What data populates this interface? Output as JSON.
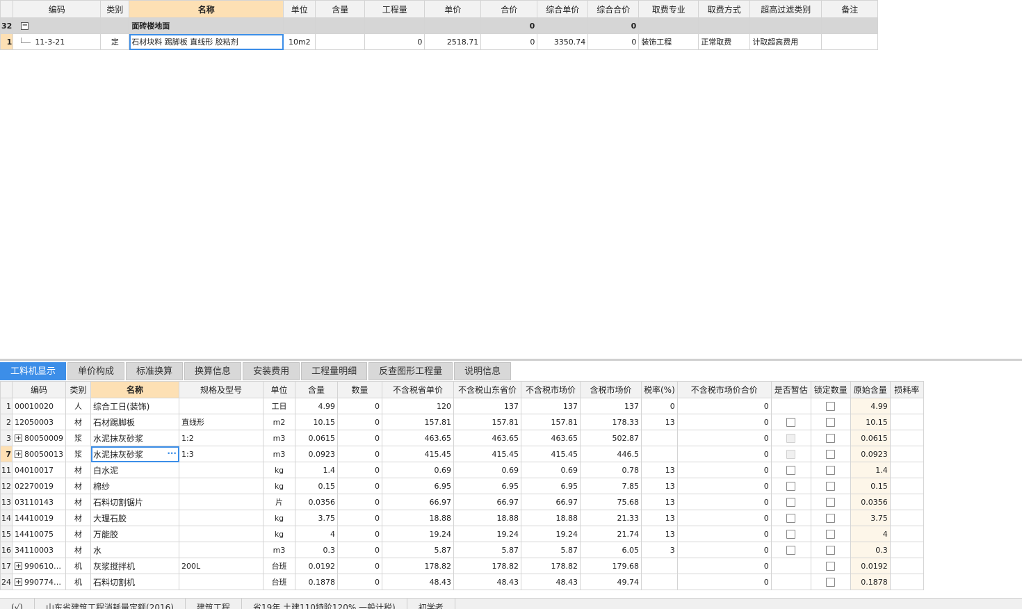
{
  "top_table": {
    "headers": [
      "编码",
      "类别",
      "名称",
      "单位",
      "含量",
      "工程量",
      "单价",
      "合价",
      "综合单价",
      "综合合价",
      "取费专业",
      "取费方式",
      "超高过滤类别",
      "备注"
    ],
    "group_row": {
      "row_num": "32",
      "collapse_glyph": "−",
      "name": "面砖楼地面",
      "price_sum": "0",
      "comp_sum": "0"
    },
    "item_row": {
      "row_num": "1",
      "code": "11-3-21",
      "type": "定",
      "name": "石材块料 踢脚板 直线形 胶粘剂",
      "unit": "10m2",
      "content": "",
      "qty": "0",
      "price": "2518.71",
      "total": "0",
      "comp_price": "3350.74",
      "comp_total": "0",
      "fee_major": "装饰工程",
      "fee_method": "正常取费",
      "filter": "计取超高费用",
      "note": ""
    }
  },
  "tabs": [
    "工料机显示",
    "单价构成",
    "标准换算",
    "换算信息",
    "安装费用",
    "工程量明细",
    "反查图形工程量",
    "说明信息"
  ],
  "bottom_table": {
    "headers": [
      "编码",
      "类别",
      "名称",
      "规格及型号",
      "单位",
      "含量",
      "数量",
      "不含税省单价",
      "不含税山东省价",
      "不含税市场价",
      "含税市场价",
      "税率(%)",
      "不含税市场价合价",
      "是否暂估",
      "锁定数量",
      "原始含量",
      "损耗率"
    ],
    "rows": [
      {
        "n": "1",
        "exp": false,
        "code": "00010020",
        "type": "人",
        "name": "综合工日(装饰)",
        "spec": "",
        "unit": "工日",
        "content": "4.99",
        "qty": "0",
        "p1": "120",
        "p2": "137",
        "p3": "137",
        "p4": "137",
        "tax": "0",
        "sum": "0",
        "est": "none",
        "orig": "4.99",
        "loss": ""
      },
      {
        "n": "2",
        "exp": false,
        "code": "12050003",
        "type": "材",
        "name": "石材踢脚板",
        "spec": "直线形",
        "unit": "m2",
        "content": "10.15",
        "qty": "0",
        "p1": "157.81",
        "p2": "157.81",
        "p3": "157.81",
        "p4": "178.33",
        "tax": "13",
        "sum": "0",
        "est": "box",
        "orig": "10.15",
        "loss": ""
      },
      {
        "n": "3",
        "exp": true,
        "code": "80050009",
        "type": "浆",
        "name": "水泥抹灰砂浆",
        "spec": "1:2",
        "unit": "m3",
        "content": "0.0615",
        "qty": "0",
        "p1": "463.65",
        "p2": "463.65",
        "p3": "463.65",
        "p4": "502.87",
        "tax": "",
        "sum": "0",
        "est": "dis",
        "orig": "0.0615",
        "loss": ""
      },
      {
        "n": "7",
        "exp": true,
        "code": "80050013",
        "type": "浆",
        "name": "水泥抹灰砂浆",
        "spec": "1:3",
        "unit": "m3",
        "content": "0.0923",
        "qty": "0",
        "p1": "415.45",
        "p2": "415.45",
        "p3": "415.45",
        "p4": "446.5",
        "tax": "",
        "sum": "0",
        "est": "dis",
        "orig": "0.0923",
        "loss": ""
      },
      {
        "n": "11",
        "exp": false,
        "code": "04010017",
        "type": "材",
        "name": "白水泥",
        "spec": "",
        "unit": "kg",
        "content": "1.4",
        "qty": "0",
        "p1": "0.69",
        "p2": "0.69",
        "p3": "0.69",
        "p4": "0.78",
        "tax": "13",
        "sum": "0",
        "est": "box",
        "orig": "1.4",
        "loss": ""
      },
      {
        "n": "12",
        "exp": false,
        "code": "02270019",
        "type": "材",
        "name": "棉纱",
        "spec": "",
        "unit": "kg",
        "content": "0.15",
        "qty": "0",
        "p1": "6.95",
        "p2": "6.95",
        "p3": "6.95",
        "p4": "7.85",
        "tax": "13",
        "sum": "0",
        "est": "box",
        "orig": "0.15",
        "loss": ""
      },
      {
        "n": "13",
        "exp": false,
        "code": "03110143",
        "type": "材",
        "name": "石料切割锯片",
        "spec": "",
        "unit": "片",
        "content": "0.0356",
        "qty": "0",
        "p1": "66.97",
        "p2": "66.97",
        "p3": "66.97",
        "p4": "75.68",
        "tax": "13",
        "sum": "0",
        "est": "box",
        "orig": "0.0356",
        "loss": ""
      },
      {
        "n": "14",
        "exp": false,
        "code": "14410019",
        "type": "材",
        "name": "大理石胶",
        "spec": "",
        "unit": "kg",
        "content": "3.75",
        "qty": "0",
        "p1": "18.88",
        "p2": "18.88",
        "p3": "18.88",
        "p4": "21.33",
        "tax": "13",
        "sum": "0",
        "est": "box",
        "orig": "3.75",
        "loss": ""
      },
      {
        "n": "15",
        "exp": false,
        "code": "14410075",
        "type": "材",
        "name": "万能胶",
        "spec": "",
        "unit": "kg",
        "content": "4",
        "qty": "0",
        "p1": "19.24",
        "p2": "19.24",
        "p3": "19.24",
        "p4": "21.74",
        "tax": "13",
        "sum": "0",
        "est": "box",
        "orig": "4",
        "loss": ""
      },
      {
        "n": "16",
        "exp": false,
        "code": "34110003",
        "type": "材",
        "name": "水",
        "spec": "",
        "unit": "m3",
        "content": "0.3",
        "qty": "0",
        "p1": "5.87",
        "p2": "5.87",
        "p3": "5.87",
        "p4": "6.05",
        "tax": "3",
        "sum": "0",
        "est": "box",
        "orig": "0.3",
        "loss": ""
      },
      {
        "n": "17",
        "exp": true,
        "code": "990610…",
        "type": "机",
        "name": "灰浆搅拌机",
        "spec": "200L",
        "unit": "台班",
        "content": "0.0192",
        "qty": "0",
        "p1": "178.82",
        "p2": "178.82",
        "p3": "178.82",
        "p4": "179.68",
        "tax": "",
        "sum": "0",
        "est": "none",
        "orig": "0.0192",
        "loss": ""
      },
      {
        "n": "24",
        "exp": true,
        "code": "990774…",
        "type": "机",
        "name": "石料切割机",
        "spec": "",
        "unit": "台班",
        "content": "0.1878",
        "qty": "0",
        "p1": "48.43",
        "p2": "48.43",
        "p3": "48.43",
        "p4": "49.74",
        "tax": "",
        "sum": "0",
        "est": "none",
        "orig": "0.1878",
        "loss": ""
      }
    ]
  },
  "status_bar": [
    "(√)",
    "山东省建筑工程消耗量定额(2016)",
    "建筑工程",
    "省19年 土建110特阶120% 一般计税)",
    "初学者"
  ]
}
